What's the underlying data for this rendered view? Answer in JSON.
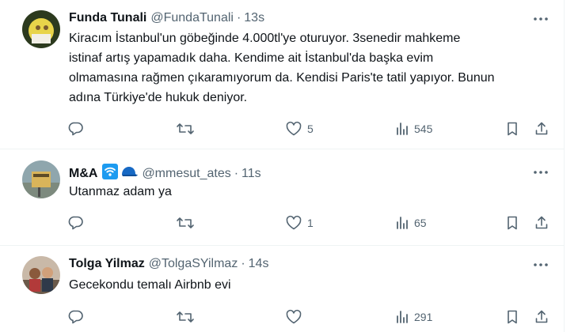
{
  "tweets": [
    {
      "name": "Funda Tunali",
      "handle": "@FundaTunali",
      "separator": "·",
      "time": "13s",
      "lines": [
        "Kiracım İstanbul'un göbeğinde 4.000tl'ye oturuyor. 3senedir mahkeme",
        "istinaf artış yapamadık daha. Kendime ait İstanbul'da başka evim",
        "olmamasına rağmen çıkaramıyorum da. Kendisi Paris'te tatil yapıyor. Bunun",
        "adına Türkiye'de hukuk deniyor."
      ],
      "likes": "5",
      "views": "545"
    },
    {
      "name": "M&A",
      "handle": "@mmesut_ates",
      "separator": "·",
      "time": "11s",
      "badge_icons": [
        "wifi-badge-icon",
        "blue-cap-icon"
      ],
      "lines": [
        "Utanmaz adam ya"
      ],
      "likes": "1",
      "views": "65"
    },
    {
      "name": "Tolga Yilmaz",
      "handle": "@TolgaSYilmaz",
      "separator": "·",
      "time": "14s",
      "lines": [
        "Gecekondu temalı Airbnb evi"
      ],
      "likes": "",
      "views": "291"
    }
  ],
  "icons": [
    "more-icon",
    "reply-icon",
    "retweet-icon",
    "like-icon",
    "views-icon",
    "bookmark-icon",
    "share-icon"
  ],
  "colors": {
    "text": "#0f1419",
    "secondary": "#536471",
    "divider": "#eff3f4"
  }
}
